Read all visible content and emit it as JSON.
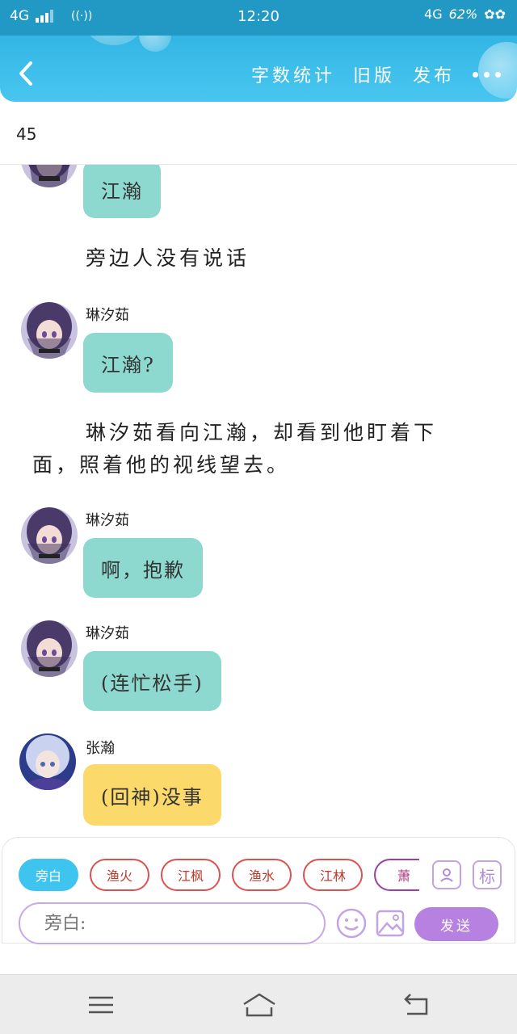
{
  "status_bar": {
    "network_left": "4G",
    "wifi_glyph": "((·))",
    "time": "12:20",
    "network_right": "4G",
    "battery": "62%"
  },
  "header": {
    "actions": [
      "字数统计",
      "旧版",
      "发布"
    ],
    "back_icon": "chevron-left-icon",
    "more_icon": "more-dots-icon"
  },
  "word_count": "45",
  "chat": {
    "messages": [
      {
        "type": "bubble",
        "color": "teal",
        "text": "江瀚",
        "avatar": "purple-hair-girl"
      },
      {
        "type": "narration",
        "text": "旁边人没有说话"
      },
      {
        "type": "bubble",
        "speaker": "琳汐茹",
        "color": "teal",
        "text": "江瀚?",
        "avatar": "purple-hair-girl"
      },
      {
        "type": "narration",
        "lines": [
          "琳汐茹看向江瀚，却看到他盯着下",
          "面，照着他的视线望去。"
        ]
      },
      {
        "type": "bubble",
        "speaker": "琳汐茹",
        "color": "teal",
        "text": "啊，抱歉",
        "avatar": "purple-hair-girl"
      },
      {
        "type": "bubble",
        "speaker": "琳汐茹",
        "color": "teal",
        "text": "(连忙松手)",
        "avatar": "purple-hair-girl"
      },
      {
        "type": "bubble",
        "speaker": "张瀚",
        "color": "yellow",
        "text": "(回神)没事",
        "avatar": "silver-hair-boy"
      }
    ]
  },
  "input_panel": {
    "roles": [
      "旁白",
      "渔火",
      "江枫",
      "渔水",
      "江林",
      "萧"
    ],
    "active_role": "旁白",
    "tool_icons": [
      "contact-card-icon"
    ],
    "tag_button": "标",
    "placeholder": "旁白:",
    "emoji_icon": "smiley-icon",
    "image_icon": "image-icon",
    "send_label": "发送"
  },
  "nav_bar": {
    "buttons": [
      "menu-icon",
      "home-icon",
      "back-icon"
    ]
  },
  "colors": {
    "header_blue": "#36b8e6",
    "teal_bubble": "#8dd9cf",
    "yellow_bubble": "#fbd96a",
    "send_purple": "#b681e1",
    "active_chip": "#3fc3ef",
    "chip_red": "#d9534f"
  }
}
